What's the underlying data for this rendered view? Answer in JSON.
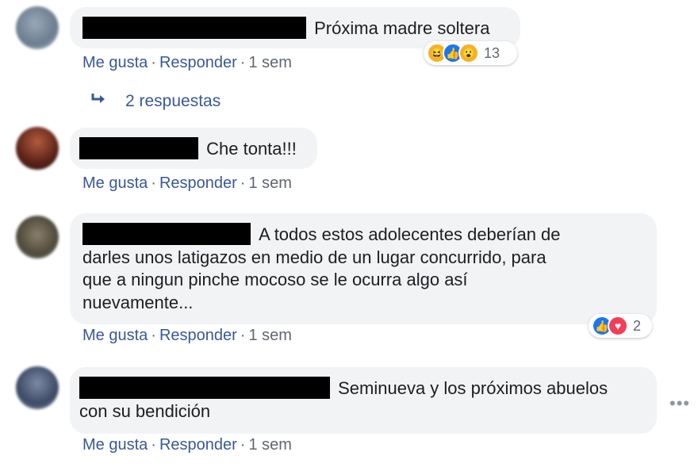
{
  "comments": [
    {
      "text": "Próxima madre soltera",
      "actions": {
        "like": "Me gusta",
        "reply": "Responder",
        "time": "1 sem"
      },
      "reactions": {
        "icons": [
          "laugh-reaction",
          "like-reaction",
          "wow-reaction"
        ],
        "count": "13"
      }
    },
    {
      "text": "Che tonta!!!",
      "actions": {
        "like": "Me gusta",
        "reply": "Responder",
        "time": "1 sem"
      }
    },
    {
      "line1": "A todos estos adolecentes deberían de",
      "line2": "darles unos latigazos en medio de un lugar concurrido, para",
      "line3": "que a ningun pinche mocoso se le ocurra algo así",
      "line4": "nuevamente...",
      "actions": {
        "like": "Me gusta",
        "reply": "Responder",
        "time": "1 sem"
      },
      "reactions": {
        "icons": [
          "like-reaction",
          "love-reaction"
        ],
        "count": "2"
      }
    },
    {
      "line1": "Seminueva y los próximos abuelos",
      "line2": "con su bendición",
      "actions": {
        "like": "Me gusta",
        "reply": "Responder",
        "time": "1 sem"
      }
    }
  ],
  "replies_link": "2 respuestas",
  "colors": {
    "link": "#385898",
    "bubble": "#f2f3f5",
    "meta": "#606770",
    "like": "#1877f2",
    "love": "#f33e58",
    "haha": "#f7b125"
  }
}
